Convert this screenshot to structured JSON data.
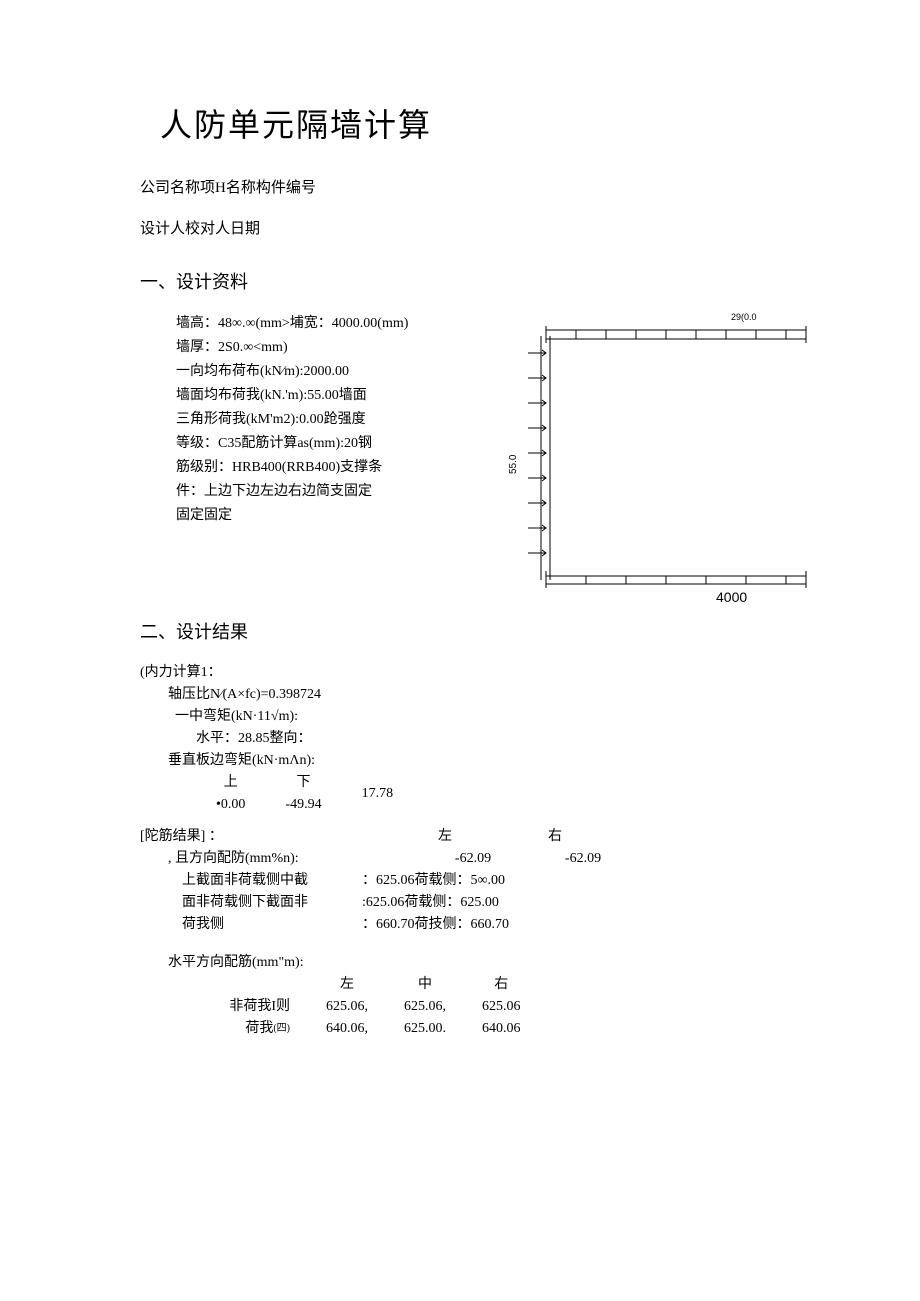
{
  "title": "人防单元隔墙计算",
  "meta_line1": "公司名称项H名称构件编号",
  "meta_line2": "设计人校对人日期",
  "section1_heading": "一、设计资料",
  "design": {
    "l1": "墙高：48∞.∞(mm>埔宽：4000.00(mm)",
    "l2": "墙厚：2S0.∞<mm)",
    "l3": "一向均布荷布(kN∕m):2000.00",
    "l4": "墙面均布荷我(kN.'m):55.00墙面",
    "l5": "三角形荷我(kM'm2):0.00跄强度",
    "l6": "等级：C35配筋计算as(mm):20钢",
    "l7": "筋级别：HRB400(RRB400)支撑条",
    "l8": "件：上边下边左边右边简支固定",
    "l9": "固定固定"
  },
  "diagram": {
    "top_label": "29(0.0",
    "bottom_label": "4000",
    "side_label": "55.0"
  },
  "section2_heading": "二、设计结果",
  "results": {
    "head": "(内力计算1：",
    "axial": "轴压比N∕(A×fc)=0.398724",
    "moment_head": "一中弯矩(kN·11√m):",
    "moment_h": "水平：28.85整向：",
    "edge_moment_head": "垂直板边弯矩(kN·mΛn):",
    "edge_cols": {
      "c1": "上",
      "c2": "下"
    },
    "edge_vals": {
      "v1": "•0.00",
      "v2": "-49.94",
      "v3": "17.78"
    },
    "lr_cols": {
      "left": "左",
      "right": "右"
    },
    "lr_vals": {
      "l": "-62.09",
      "r": "-62.09"
    }
  },
  "rebar": {
    "head": "[陀筋结果] ：",
    "vert_head": ", 且方向配防(mm%n):",
    "r1_label": "上截面非荷载侧中截",
    "r1_val": "：625.06荷载侧：5∞.00",
    "r2_label": "面非荷载侧下截面非",
    "r2_val": ":625.06荷载侧：625.00",
    "r3_label": "荷我侧",
    "r3_val": "：660.70荷技侧：660.70",
    "horiz_head": "水平方向配筋(mm\"m):",
    "h_cols": {
      "c1": "左",
      "c2": "中",
      "c3": "右"
    },
    "h_row1_label": "非荷我I则",
    "h_row1": {
      "v1": "625.06,",
      "v2": "625.06,",
      "v3": "625.06"
    },
    "h_row2_label": "荷我",
    "h_row2_sub": "(四)",
    "h_row2": {
      "v1": "640.06,",
      "v2": "625.00.",
      "v3": "640.06"
    }
  }
}
